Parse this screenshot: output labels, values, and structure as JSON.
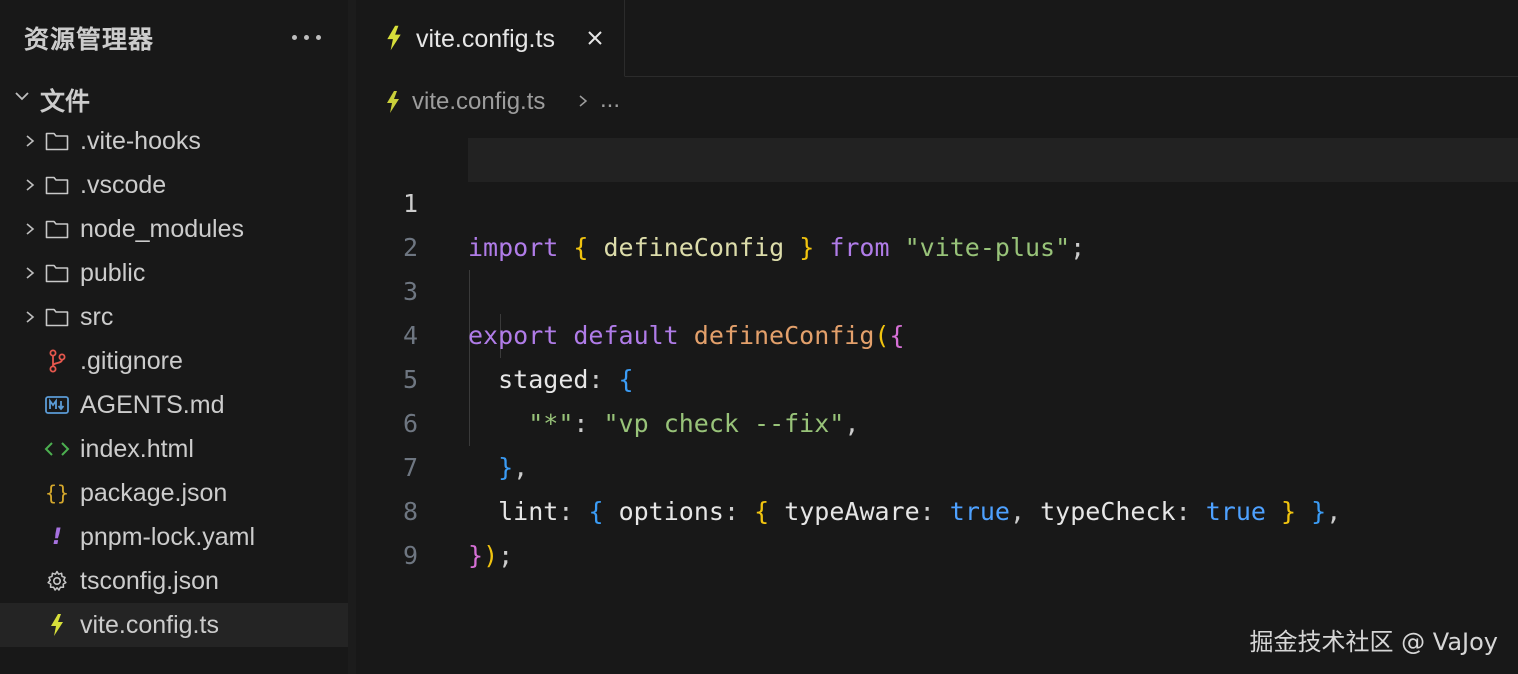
{
  "sidebar": {
    "title": "资源管理器",
    "more_icon": "ellipsis-icon",
    "section_title": "文件",
    "items": [
      {
        "label": ".vite-hooks",
        "type": "folder",
        "icon": "folder-icon"
      },
      {
        "label": ".vscode",
        "type": "folder",
        "icon": "folder-icon"
      },
      {
        "label": "node_modules",
        "type": "folder",
        "icon": "folder-icon"
      },
      {
        "label": "public",
        "type": "folder",
        "icon": "folder-icon"
      },
      {
        "label": "src",
        "type": "folder",
        "icon": "folder-icon"
      },
      {
        "label": ".gitignore",
        "type": "file",
        "icon": "git-icon"
      },
      {
        "label": "AGENTS.md",
        "type": "file",
        "icon": "markdown-icon"
      },
      {
        "label": "index.html",
        "type": "file",
        "icon": "html-icon"
      },
      {
        "label": "package.json",
        "type": "file",
        "icon": "json-icon"
      },
      {
        "label": "pnpm-lock.yaml",
        "type": "file",
        "icon": "yaml-icon"
      },
      {
        "label": "tsconfig.json",
        "type": "file",
        "icon": "gear-icon"
      },
      {
        "label": "vite.config.ts",
        "type": "file",
        "icon": "vite-icon",
        "selected": true
      }
    ]
  },
  "editor": {
    "tab": {
      "label": "vite.config.ts",
      "close": "×"
    },
    "breadcrumb": {
      "file": "vite.config.ts",
      "more": "..."
    },
    "line_numbers": [
      "1",
      "2",
      "3",
      "4",
      "5",
      "6",
      "7",
      "8",
      "9"
    ],
    "code": {
      "l1": {
        "import": "import",
        "b1": "{",
        "name": "defineConfig",
        "b2": "}",
        "from": "from",
        "str": "\"vite-plus\"",
        "end": ";"
      },
      "l3": {
        "export": "export",
        "default": "default",
        "fn": "defineConfig",
        "p": "(",
        "b": "{"
      },
      "l4": {
        "key": "staged",
        "colon": ":",
        "b": "{"
      },
      "l5": {
        "str1": "\"*\"",
        "colon": ":",
        "str2": "\"vp check --fix\"",
        "comma": ","
      },
      "l6": {
        "b": "}",
        "comma": ","
      },
      "l7": {
        "key": "lint",
        "c1": ":",
        "b1": "{",
        "opt": "options",
        "c2": ":",
        "b2": "{",
        "ta": "typeAware",
        "c3": ":",
        "v1": "true",
        "comma1": ",",
        "tc": "typeCheck",
        "c4": ":",
        "v2": "true",
        "b3": "}",
        "b4": "}",
        "comma2": ","
      },
      "l8": {
        "b": "}",
        "p": ")",
        "end": ";"
      }
    }
  },
  "colors": {
    "background": "#181818",
    "keyword": "#c586c0",
    "string": "#98c379",
    "function": "#dcdcaa",
    "boolean": "#4ea1ff",
    "vite_icon": "#d7df3a"
  },
  "watermark": "掘金技术社区 @ VaJoy"
}
